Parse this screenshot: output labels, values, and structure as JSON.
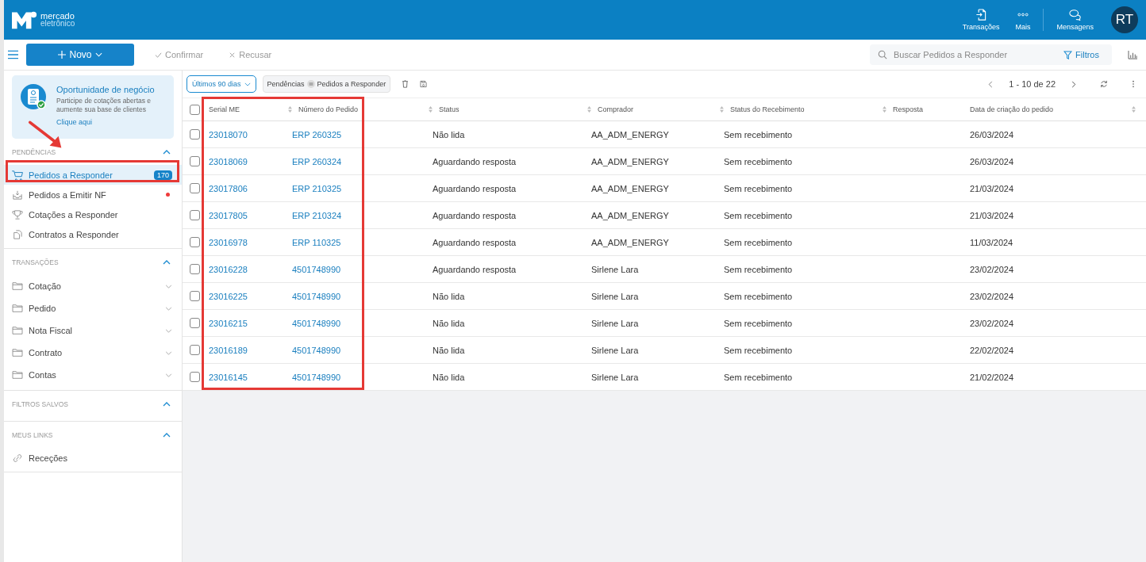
{
  "header": {
    "brand": [
      "mercado",
      "eletrônico"
    ],
    "actions": [
      {
        "label": "Transações",
        "kind": "doc"
      },
      {
        "label": "Mais",
        "kind": "dots"
      },
      {
        "label": "Mensagens",
        "kind": "chat"
      }
    ],
    "avatar": "RT"
  },
  "toolbar": {
    "new_button": "Novo",
    "actions": [
      {
        "label": "Confirmar",
        "kind": "check"
      },
      {
        "label": "Recusar",
        "kind": "cross"
      }
    ],
    "search": {
      "placeholder": "Buscar Pedidos a Responder"
    },
    "filters": "Filtros"
  },
  "promo": {
    "title": "Oportunidade de negócio",
    "text": "Participe de cotações abertas e aumente sua base de clientes",
    "link": "Clique aqui"
  },
  "sidebar": [
    {
      "title": "PENDÊNCIAS",
      "expanded": true,
      "items": [
        {
          "label": "Pedidos a Responder",
          "kind": "cart",
          "selected": true,
          "badge": "170",
          "dot": false
        },
        {
          "label": "Pedidos a Emitir NF",
          "kind": "inbox",
          "selected": false,
          "dot": true
        },
        {
          "label": "Cotações a Responder",
          "kind": "trophy",
          "selected": false,
          "dot": false
        },
        {
          "label": "Contratos a Responder",
          "kind": "contract",
          "selected": false,
          "dot": false
        }
      ]
    },
    {
      "title": "TRANSAÇÕES",
      "expanded": true,
      "items": [
        {
          "label": "Cotação",
          "kind": "folder",
          "selected": false,
          "dot": false,
          "expanded": false
        },
        {
          "label": "Pedido",
          "kind": "folder",
          "selected": false,
          "dot": false,
          "expanded": false
        },
        {
          "label": "Nota Fiscal",
          "kind": "folder",
          "selected": false,
          "dot": false,
          "expanded": false
        },
        {
          "label": "Contrato",
          "kind": "folder",
          "selected": false,
          "dot": false,
          "expanded": false
        },
        {
          "label": "Contas",
          "kind": "folder",
          "selected": false,
          "dot": false,
          "expanded": false
        }
      ]
    },
    {
      "title": "FILTROS SALVOS",
      "expanded": true
    },
    {
      "title": "MEUS LINKS",
      "expanded": true,
      "items": [
        {
          "label": "Receções",
          "kind": "link",
          "selected": false,
          "dot": false
        }
      ]
    }
  ],
  "filter_bar": {
    "period": "Últimos 90 dias",
    "chip": {
      "field": "Pendências",
      "value": "Pedidos a Responder"
    },
    "pagination": "1 - 10 de 22"
  },
  "table": {
    "all_checked": false,
    "columns": [
      "Serial ME",
      "Número do Pedido",
      "Status",
      "Comprador",
      "Status do Recebimento",
      "Resposta",
      "Data de criação do pedido"
    ],
    "rows": [
      {
        "serial": "23018070",
        "pedido": "ERP 260325",
        "status": "Não lida",
        "comprador": "AA_ADM_ENERGY",
        "recebimento": "Sem recebimento",
        "data": "26/03/2024",
        "checked": false
      },
      {
        "serial": "23018069",
        "pedido": "ERP 260324",
        "status": "Aguardando resposta",
        "comprador": "AA_ADM_ENERGY",
        "recebimento": "Sem recebimento",
        "data": "26/03/2024",
        "checked": false
      },
      {
        "serial": "23017806",
        "pedido": "ERP 210325",
        "status": "Aguardando resposta",
        "comprador": "AA_ADM_ENERGY",
        "recebimento": "Sem recebimento",
        "data": "21/03/2024",
        "checked": false
      },
      {
        "serial": "23017805",
        "pedido": "ERP 210324",
        "status": "Aguardando resposta",
        "comprador": "AA_ADM_ENERGY",
        "recebimento": "Sem recebimento",
        "data": "21/03/2024",
        "checked": false
      },
      {
        "serial": "23016978",
        "pedido": "ERP 110325",
        "status": "Aguardando resposta",
        "comprador": "AA_ADM_ENERGY",
        "recebimento": "Sem recebimento",
        "data": "11/03/2024",
        "checked": false
      },
      {
        "serial": "23016228",
        "pedido": "4501748990",
        "status": "Aguardando resposta",
        "comprador": "Sirlene Lara",
        "recebimento": "Sem recebimento",
        "data": "23/02/2024",
        "checked": false
      },
      {
        "serial": "23016225",
        "pedido": "4501748990",
        "status": "Não lida",
        "comprador": "Sirlene Lara",
        "recebimento": "Sem recebimento",
        "data": "23/02/2024",
        "checked": false
      },
      {
        "serial": "23016215",
        "pedido": "4501748990",
        "status": "Não lida",
        "comprador": "Sirlene Lara",
        "recebimento": "Sem recebimento",
        "data": "23/02/2024",
        "checked": false
      },
      {
        "serial": "23016189",
        "pedido": "4501748990",
        "status": "Não lida",
        "comprador": "Sirlene Lara",
        "recebimento": "Sem recebimento",
        "data": "22/02/2024",
        "checked": false
      },
      {
        "serial": "23016145",
        "pedido": "4501748990",
        "status": "Não lida",
        "comprador": "Sirlene Lara",
        "recebimento": "Sem recebimento",
        "data": "21/02/2024",
        "checked": false
      }
    ]
  }
}
